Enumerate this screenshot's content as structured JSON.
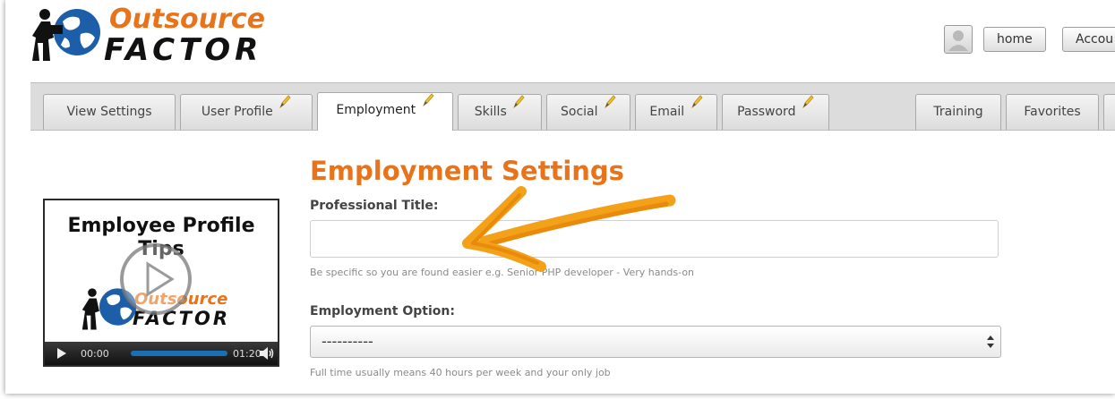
{
  "brand": {
    "logo_top": "Outsource",
    "logo_bottom": "FACTOR",
    "primary_color": "#e8731a"
  },
  "topbar": {
    "home_label": "home",
    "account_label": "Accou"
  },
  "tabs": [
    {
      "label": "View Settings",
      "editable": false
    },
    {
      "label": "User Profile",
      "editable": true
    },
    {
      "label": "Employment",
      "editable": true,
      "active": true
    },
    {
      "label": "Skills",
      "editable": true
    },
    {
      "label": "Social",
      "editable": true
    },
    {
      "label": "Email",
      "editable": true
    },
    {
      "label": "Password",
      "editable": true
    },
    {
      "label": "Training",
      "editable": false
    },
    {
      "label": "Favorites",
      "editable": false
    }
  ],
  "main": {
    "title": "Employment Settings",
    "professional_title": {
      "label": "Professional Title:",
      "value": "",
      "hint": "Be specific so you are found easier e.g. Senior PHP developer - Very hands-on"
    },
    "employment_option": {
      "label": "Employment Option:",
      "selected": "----------",
      "hint": "Full time usually means 40 hours per week and your only job"
    }
  },
  "video": {
    "title": "Employee Profile Tips",
    "logo_top": "Outsource",
    "logo_bottom": "FACTOR",
    "current_time": "00:00",
    "duration": "01:20"
  },
  "icons": {
    "tab_edit": "pencil-icon",
    "play": "play-icon",
    "volume": "volume-icon",
    "select": "select-arrows-icon",
    "annotation": "arrow-icon"
  }
}
